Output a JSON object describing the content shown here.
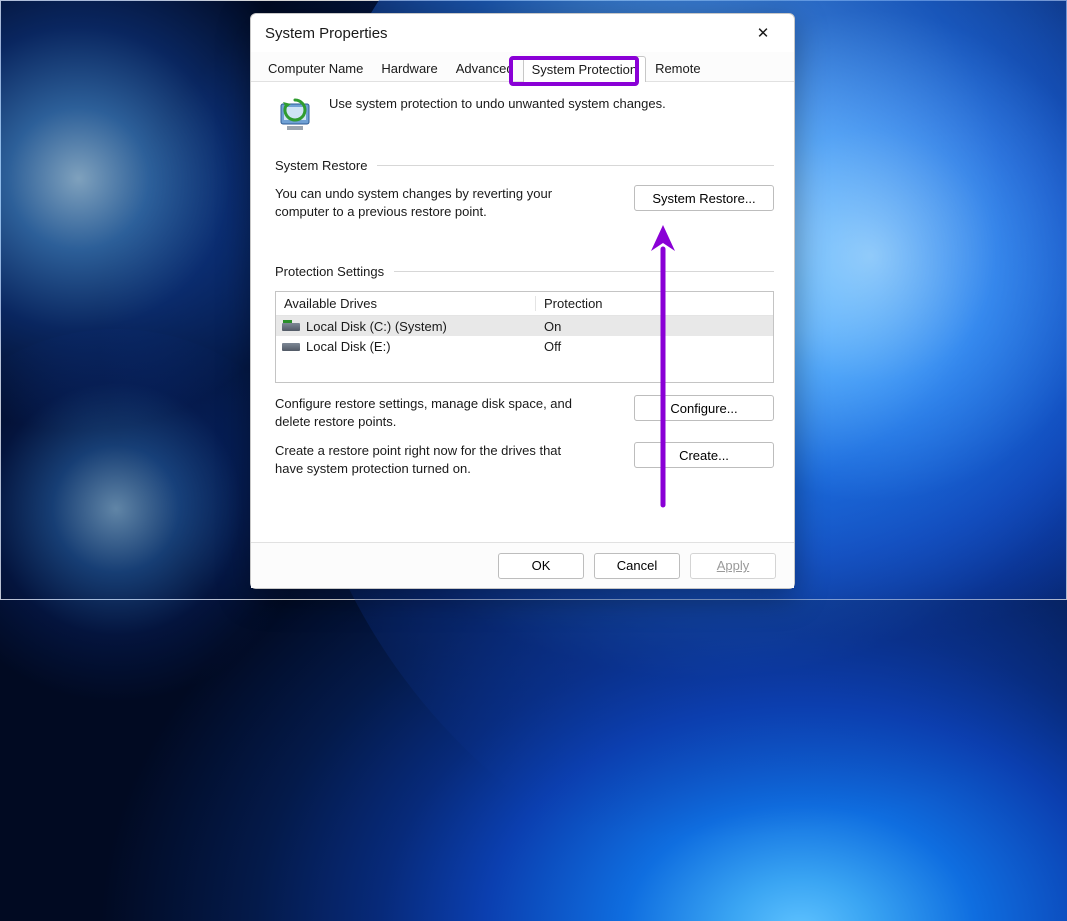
{
  "window": {
    "title": "System Properties"
  },
  "tabs": {
    "computer_name": "Computer Name",
    "hardware": "Hardware",
    "advanced": "Advanced",
    "system_protection": "System Protection",
    "remote": "Remote"
  },
  "intro": {
    "text": "Use system protection to undo unwanted system changes."
  },
  "restore": {
    "section": "System Restore",
    "desc": "You can undo system changes by reverting your computer to a previous restore point.",
    "button": "System Restore..."
  },
  "protection": {
    "section": "Protection Settings",
    "header_drives": "Available Drives",
    "header_protection": "Protection",
    "drives": [
      {
        "name": "Local Disk (C:) (System)",
        "status": "On"
      },
      {
        "name": "Local Disk (E:)",
        "status": "Off"
      }
    ],
    "configure_desc": "Configure restore settings, manage disk space, and delete restore points.",
    "configure_button": "Configure...",
    "create_desc": "Create a restore point right now for the drives that have system protection turned on.",
    "create_button": "Create..."
  },
  "footer": {
    "ok": "OK",
    "cancel": "Cancel",
    "apply": "Apply"
  },
  "annotation": {
    "highlight_target": "system-protection-tab",
    "arrow_target": "system-restore-button"
  }
}
